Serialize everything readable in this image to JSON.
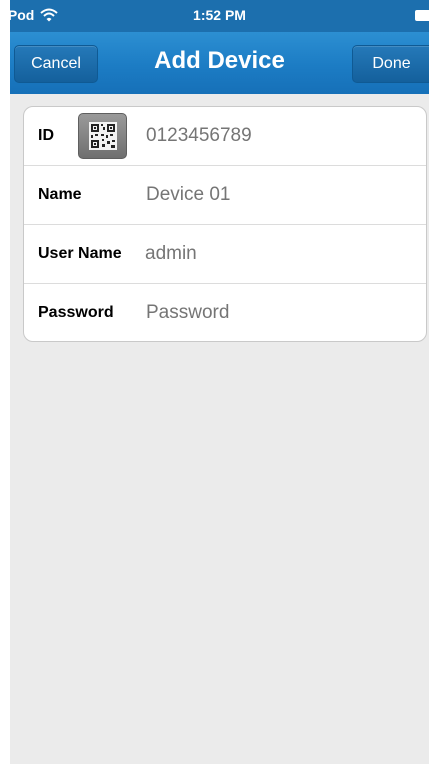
{
  "status_bar": {
    "carrier": "iPod",
    "time": "1:52 PM",
    "wifi_icon": "wifi-icon",
    "battery_icon": "battery-icon"
  },
  "nav": {
    "cancel_label": "Cancel",
    "title": "Add Device",
    "done_label": "Done"
  },
  "form": {
    "id": {
      "label": "ID",
      "placeholder": "0123456789",
      "qr_icon": "qr-code-icon"
    },
    "name": {
      "label": "Name",
      "placeholder": "Device 01"
    },
    "user_name": {
      "label": "User Name",
      "placeholder": "admin"
    },
    "password": {
      "label": "Password",
      "placeholder": "Password"
    }
  },
  "colors": {
    "nav_bar": "#1c7cc4",
    "status_bar": "#1c6fae",
    "background": "#ebebeb",
    "placeholder_text": "#b6b6b6"
  }
}
